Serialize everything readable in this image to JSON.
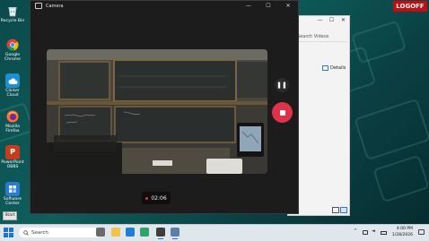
{
  "desktop": {
    "icons": [
      {
        "label": "Recycle Bin",
        "icon": "recycle-bin-icon"
      },
      {
        "label": "Google Chrome",
        "icon": "chrome-icon"
      },
      {
        "label": "Clicker Cloud",
        "icon": "clicker-cloud-icon"
      },
      {
        "label": "Mozilla Firefox",
        "icon": "firefox-icon"
      },
      {
        "label": "PowerPoint OBBS",
        "icon": "powerpoint-icon"
      },
      {
        "label": "Software Center",
        "icon": "software-center-icon"
      }
    ],
    "logoff_label": "LOGOFF",
    "start_label": "Start"
  },
  "camera": {
    "title": "Camera",
    "controls": [
      "—",
      "☐",
      "✕"
    ],
    "pause_glyph": "❚❚",
    "timer": "02:06",
    "accent": "#e0334a"
  },
  "explorer": {
    "controls": [
      "—",
      "☐",
      "✕"
    ],
    "search_placeholder": "Search Videos",
    "details_label": "Details"
  },
  "taskbar": {
    "search_placeholder": "Search",
    "tray_icons": [
      "chevron-up-icon",
      "network-icon",
      "volume-icon",
      "battery-icon"
    ],
    "time": "4:00 PM",
    "date": "1/28/2026"
  }
}
